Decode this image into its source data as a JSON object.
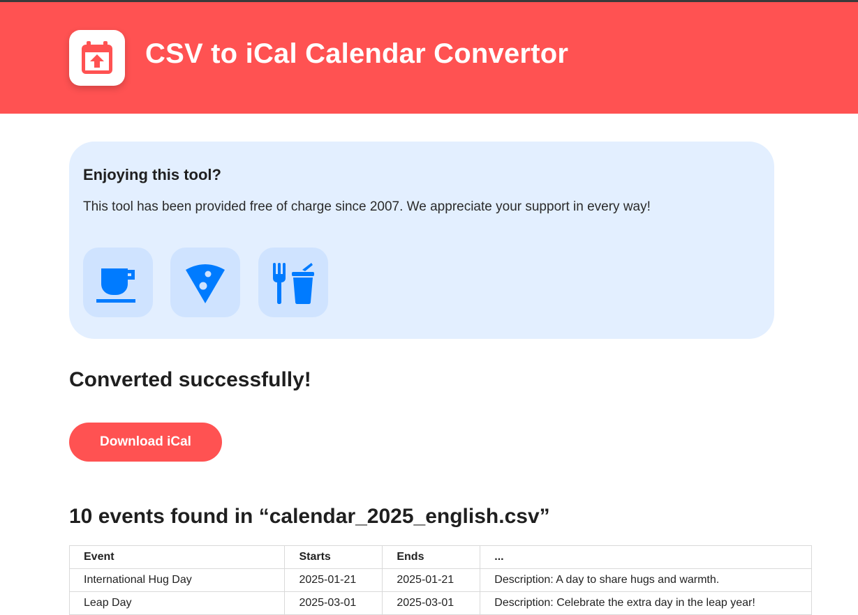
{
  "header": {
    "title": "CSV to iCal Calendar Convertor",
    "logo_icon": "calendar-upload-icon",
    "background_color": "#ff5252"
  },
  "support": {
    "title": "Enjoying this tool?",
    "text": "This tool has been provided free of charge since 2007. We appreciate your support in every way!",
    "options": [
      {
        "icon": "coffee-cup-icon"
      },
      {
        "icon": "pizza-slice-icon"
      },
      {
        "icon": "fork-drink-icon"
      }
    ],
    "accent_color": "#007bff",
    "card_color": "#e3efff"
  },
  "result": {
    "status": "Converted successfully!",
    "download_label": "Download iCal"
  },
  "events": {
    "heading": "10 events found in “calendar_2025_english.csv”",
    "columns": [
      "Event",
      "Starts",
      "Ends",
      "..."
    ],
    "rows": [
      [
        "International Hug Day",
        "2025-01-21",
        "2025-01-21",
        "Description: A day to share hugs and warmth."
      ],
      [
        "Leap Day",
        "2025-03-01",
        "2025-03-01",
        "Description: Celebrate the extra day in the leap year!"
      ]
    ]
  }
}
